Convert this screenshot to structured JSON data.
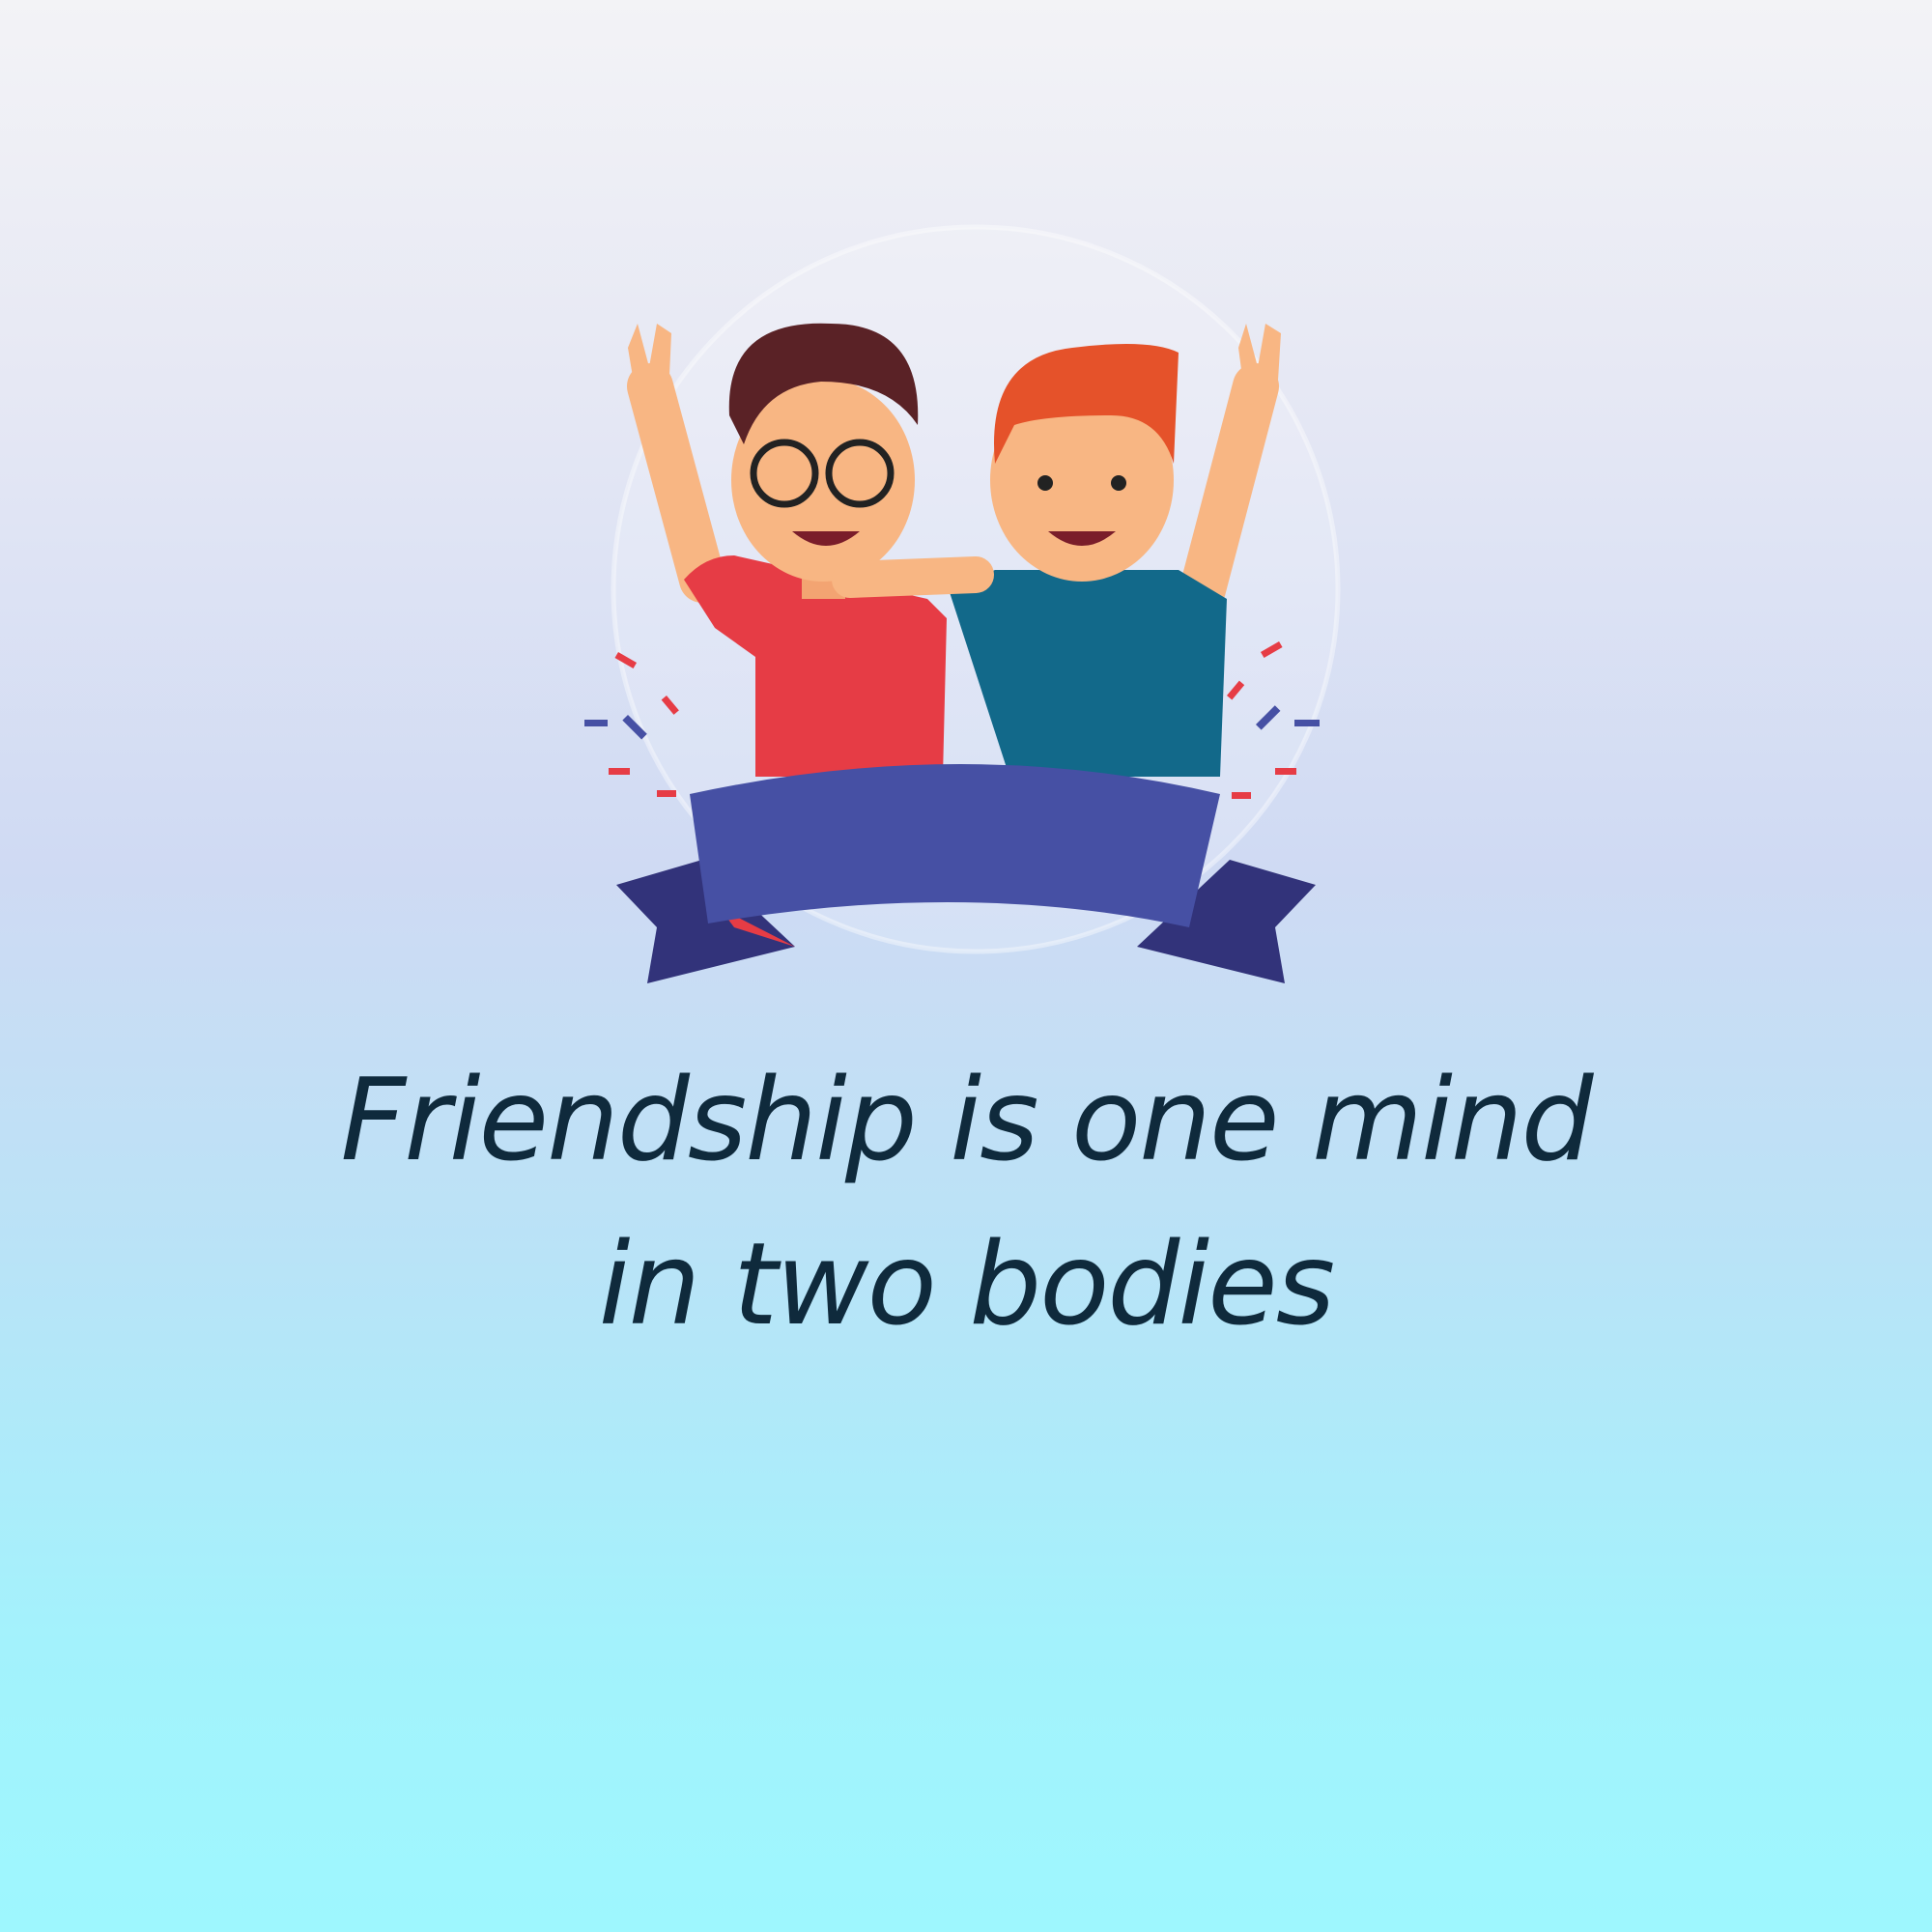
{
  "quote": {
    "line1": "Friendship is one mind",
    "line2": "in two bodies"
  },
  "colors": {
    "text": "#0f2a3c",
    "ribbon": "#4650a4",
    "ribbon_tail": "#32337a",
    "left_shirt": "#e63c45",
    "right_shirt": "#12698a",
    "skin": "#f8b683",
    "left_hair": "#5a2226",
    "right_hair": "#e5522a"
  }
}
